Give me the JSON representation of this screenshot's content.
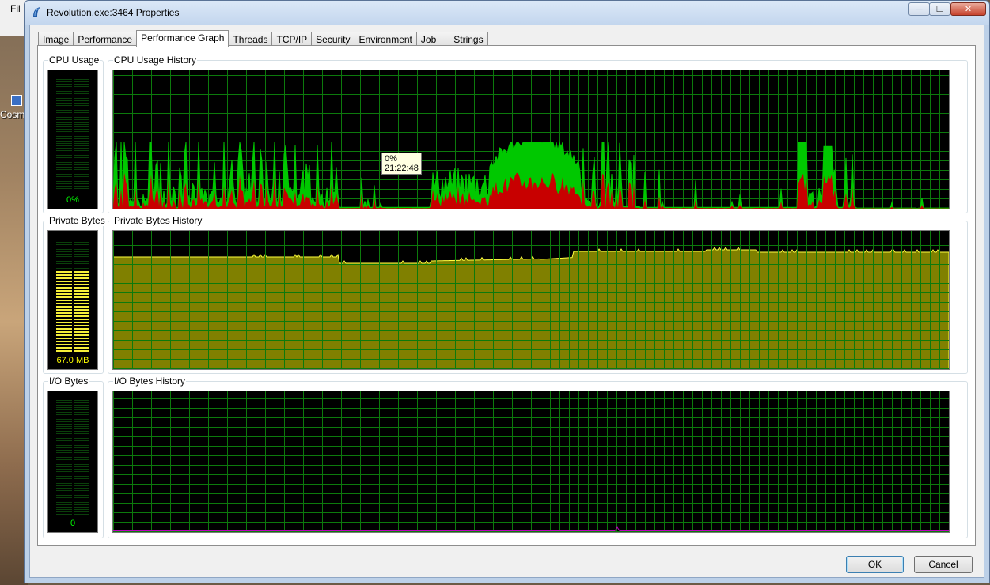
{
  "desktop": {
    "menu_label": "Fil",
    "icon_label": "Cosm Kit D"
  },
  "window": {
    "title": "Revolution.exe:3464 Properties",
    "controls": {
      "minimize": "─",
      "maximize": "☐",
      "close": "✕"
    }
  },
  "tabs": [
    {
      "label": "Image"
    },
    {
      "label": "Performance"
    },
    {
      "label": "Performance Graph",
      "active": true
    },
    {
      "label": "Threads"
    },
    {
      "label": "TCP/IP"
    },
    {
      "label": "Security"
    },
    {
      "label": "Environment"
    },
    {
      "label": "Job"
    },
    {
      "label": "Strings"
    }
  ],
  "cpu": {
    "meter_title": "CPU Usage",
    "meter_value": "0%",
    "history_title": "CPU Usage History",
    "tooltip": {
      "value": "0%",
      "time": "21:22:48"
    }
  },
  "private_bytes": {
    "meter_title": "Private Bytes",
    "meter_value": "67.0 MB",
    "history_title": "Private Bytes History",
    "meter_fill_fraction": 0.72
  },
  "io": {
    "meter_title": "I/O Bytes",
    "meter_value": "0",
    "history_title": "I/O Bytes History"
  },
  "buttons": {
    "ok": "OK",
    "cancel": "Cancel"
  },
  "colors": {
    "grid": "#0c7a0c",
    "cpu_total": "#00c800",
    "cpu_kernel": "#c80000",
    "private_fill": "#808000",
    "private_line": "#ffff40",
    "io_line": "#c000c0",
    "meter_text_green": "#00ff00",
    "meter_text_yellow": "#ffff00"
  }
}
